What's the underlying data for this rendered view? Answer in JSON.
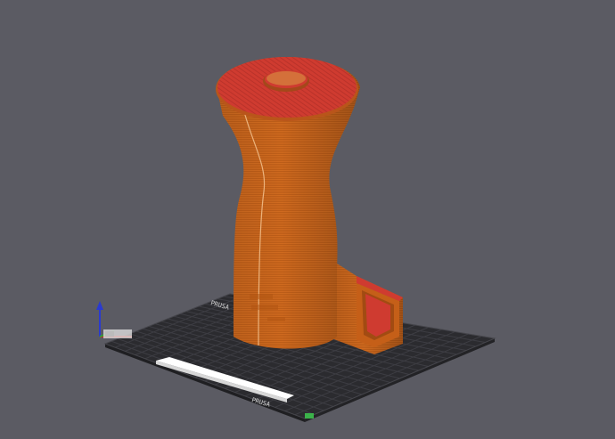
{
  "viewport": {
    "background": "#5b5b63",
    "bed_color": "#2b2b2f",
    "grid_color": "#3d3d43",
    "model_color": "#d2691e",
    "top_surface_color": "#cf3b30"
  },
  "bed": {
    "logo_text": "PRUSA",
    "bottom_label": "PRUSA"
  },
  "axes": {
    "z_icon": "z-axis-arrow-icon",
    "x_icon": "x-axis-line-icon",
    "y_icon": "y-axis-line-icon"
  }
}
